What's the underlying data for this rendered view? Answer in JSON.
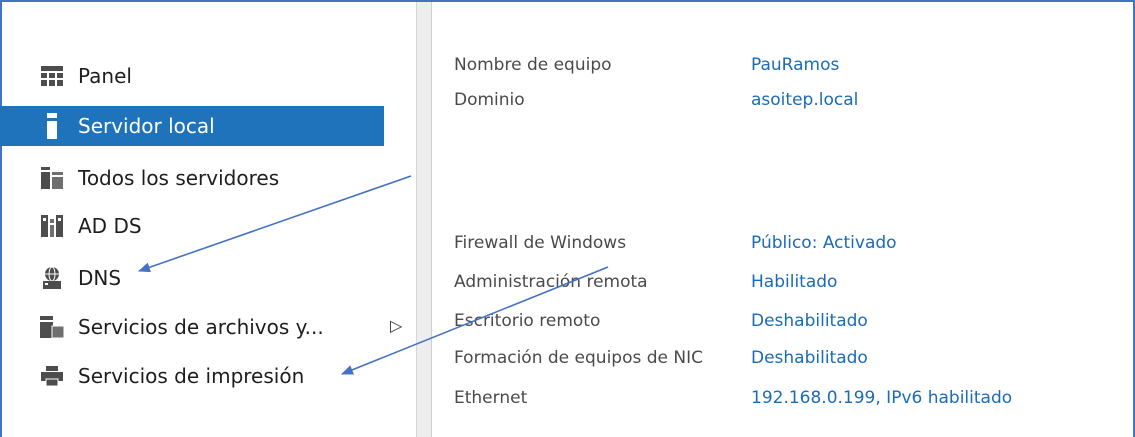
{
  "sidebar": {
    "items": [
      {
        "label": "Panel",
        "icon": "dashboard-icon",
        "selected": false
      },
      {
        "label": "Servidor local",
        "icon": "server-icon",
        "selected": true
      },
      {
        "label": "Todos los servidores",
        "icon": "servers-icon",
        "selected": false
      },
      {
        "label": "AD DS",
        "icon": "ad-ds-icon",
        "selected": false
      },
      {
        "label": "DNS",
        "icon": "dns-icon",
        "selected": false
      },
      {
        "label": "Servicios de archivos y...",
        "icon": "file-services-icon",
        "selected": false,
        "expandable": true
      },
      {
        "label": "Servicios de impresión",
        "icon": "printer-icon",
        "selected": false
      }
    ],
    "selected_color": "#1f73ba"
  },
  "properties": {
    "rows": [
      {
        "label": "Nombre de equipo",
        "value": "PauRamos"
      },
      {
        "label": "Dominio",
        "value": "asoitep.local"
      },
      {
        "label": "Firewall de Windows",
        "value": "Público: Activado"
      },
      {
        "label": "Administración remota",
        "value": "Habilitado"
      },
      {
        "label": "Escritorio remoto",
        "value": "Deshabilitado"
      },
      {
        "label": "Formación de equipos de NIC",
        "value": "Deshabilitado"
      },
      {
        "label": "Ethernet",
        "value": "192.168.0.199, IPv6 habilitado"
      }
    ],
    "value_color": "#1a6bb8"
  },
  "annotation_color": "#4472c4"
}
